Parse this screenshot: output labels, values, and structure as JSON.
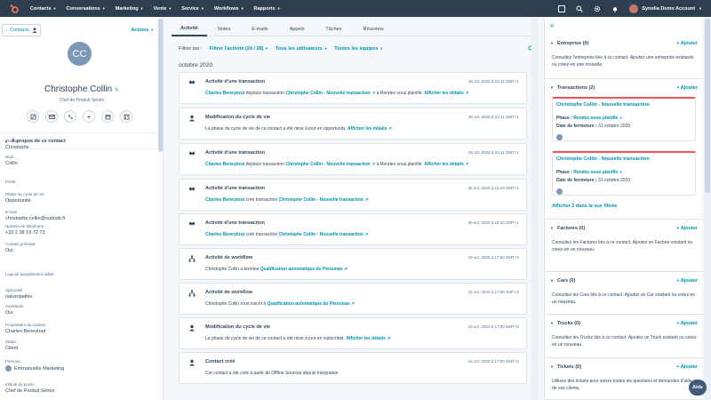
{
  "nav": {
    "items": [
      "Contacts",
      "Conversations",
      "Marketing",
      "Vente",
      "Service",
      "Workflows",
      "Rapports"
    ],
    "account": "Synolia Demo Account"
  },
  "left": {
    "back": "Contacts",
    "actions": "Actions",
    "initials": "CC",
    "name": "Christophe Collin",
    "title": "Chef de Produit Sénior",
    "section": "À propos de ce contact",
    "props": [
      {
        "label": "Prénom",
        "value": "Christophe"
      },
      {
        "label": "Nom",
        "value": "Collin"
      },
      {
        "label": "Poste",
        "value": ""
      },
      {
        "label": "Phase du cycle de vie",
        "value": "Opportunité"
      },
      {
        "label": "E-mail",
        "value": "christophe.collin@outlook.fr"
      },
      {
        "label": "Numéro de téléphone",
        "value": "+33 2 38 19 72 73"
      },
      {
        "label": "Contact principal",
        "value": "Oui"
      },
      {
        "label": "Logiciel actuellement utilisé",
        "value": ""
      },
      {
        "label": "Spécialité",
        "value": "naturopathie"
      },
      {
        "label": "Assistante",
        "value": "Oui"
      },
      {
        "label": "Propriétaire du contact",
        "value": "Charles Beneytout"
      },
      {
        "label": "Statut",
        "value": "Client"
      },
      {
        "label": "Persona",
        "value": "Emmanuelle Marketing"
      },
      {
        "label": "Intitulé du poste",
        "value": "Chef de Produit Sénior"
      }
    ]
  },
  "mid": {
    "tabs": [
      "Activité",
      "Notes",
      "E-mails",
      "Appels",
      "Tâches",
      "Réunions"
    ],
    "filter_label": "Filtrer par :",
    "filter_activity": "Filtrer l'activité (24 / 28)",
    "filter_users": "Tous les utilisateurs",
    "filter_teams": "Toutes les équipes",
    "month": "octobre 2020",
    "cards": [
      {
        "title": "Activité d'une transaction",
        "date": "26 oct. 2020 à 15:11 GMT+1",
        "pre": "Charles Beneytout",
        "mid": " déplacé transaction ",
        "link": "Christophe Collin - Nouvelle transaction",
        "post": " à Rendez-vous planifié. ",
        "details": "Afficher les détails"
      },
      {
        "title": "Modification du cycle de vie",
        "date": "26 oct. 2020 à 15:11 GMT+1",
        "pre": "",
        "mid": "La phase du cycle de vie de ce contact a été mise à jour en opportunity. ",
        "link": "",
        "post": "",
        "details": "Afficher les détails"
      },
      {
        "title": "Activité d'une transaction",
        "date": "26 oct. 2020 à 15:11 GMT+1",
        "pre": "Charles Beneytout",
        "mid": " déplacé transaction ",
        "link": "Christophe Collin - Nouvelle transaction",
        "post": " à Rendez-vous planifié. ",
        "details": "Afficher les détails"
      },
      {
        "title": "Activité d'une transaction",
        "date": "26 oct. 2020 à 15:10 GMT+1",
        "pre": "Charles Beneytout",
        "mid": " créé transaction ",
        "link": "Christophe Collin - Nouvelle transaction",
        "post": "",
        "details": ""
      },
      {
        "title": "Activité d'une transaction",
        "date": "26 oct. 2020 à 15:10 GMT+1",
        "pre": "Charles Beneytout",
        "mid": " créé transaction ",
        "link": "Christophe Collin - Nouvelle transaction",
        "post": "",
        "details": ""
      },
      {
        "title": "Activité de workflow",
        "date": "15 oct. 2020 à 17:50 GMT+2",
        "pre": "",
        "mid": "Christophe Collin a terminé ",
        "link": "Qualification automatique du Personae",
        "post": "",
        "details": ""
      },
      {
        "title": "Activité de workflow",
        "date": "15 oct. 2020 à 17:50 GMT+2",
        "pre": "",
        "mid": "Christophe Collin s'est inscrit à ",
        "link": "Qualification automatique du Personae",
        "post": "",
        "details": ""
      },
      {
        "title": "Modification du cycle de vie",
        "date": "15 oct. 2020 à 17:50 GMT+2",
        "pre": "",
        "mid": "La phase du cycle de vie de ce contact a été mise à jour en subscriber. ",
        "link": "",
        "post": "",
        "details": "Afficher les détails"
      },
      {
        "title": "Contact créé",
        "date": "15 oct. 2020 à 17:50 GMT+2",
        "pre": "",
        "mid": "Cet contact a été créé à partir de Offline Sources depuis Integration",
        "link": "",
        "post": "",
        "details": ""
      }
    ]
  },
  "right": {
    "add": "+ Ajouter",
    "sections": [
      {
        "title": "Entreprise (0)",
        "desc": "Consultez l'entreprise liée à ce contact. Ajoutez une entreprise existante ou créez-en une nouvelle."
      },
      {
        "title": "Transactions (2)",
        "desc": ""
      },
      {
        "title": "Factures (0)",
        "desc": "Consultez les Factures liés à ce contact. Ajoutez un Facture existant ou créez-en un nouveau."
      },
      {
        "title": "Cars (0)",
        "desc": "Consultez les Cars liés à ce contact. Ajoutez un Car existant ou créez-en un nouveau."
      },
      {
        "title": "Trucks (0)",
        "desc": "Consultez les Trucks liés à ce contact. Ajoutez un Truck existant ou créez-en un nouveau."
      },
      {
        "title": "Tickets (0)",
        "desc": "Utilisez des tickets pour suivre toutes les questions et demandes d'aide de vos clients."
      }
    ],
    "deal_name": "Christophe Collin - Nouvelle transaction",
    "deal_phase_label": "Phase :",
    "deal_phase": "Rendez-vous planifié",
    "deal_close_label": "Date de fermeture :",
    "deal_close": "31 octobre 2020",
    "view_all": "Afficher 2 dans la vue filtrée"
  },
  "help": "Aide"
}
